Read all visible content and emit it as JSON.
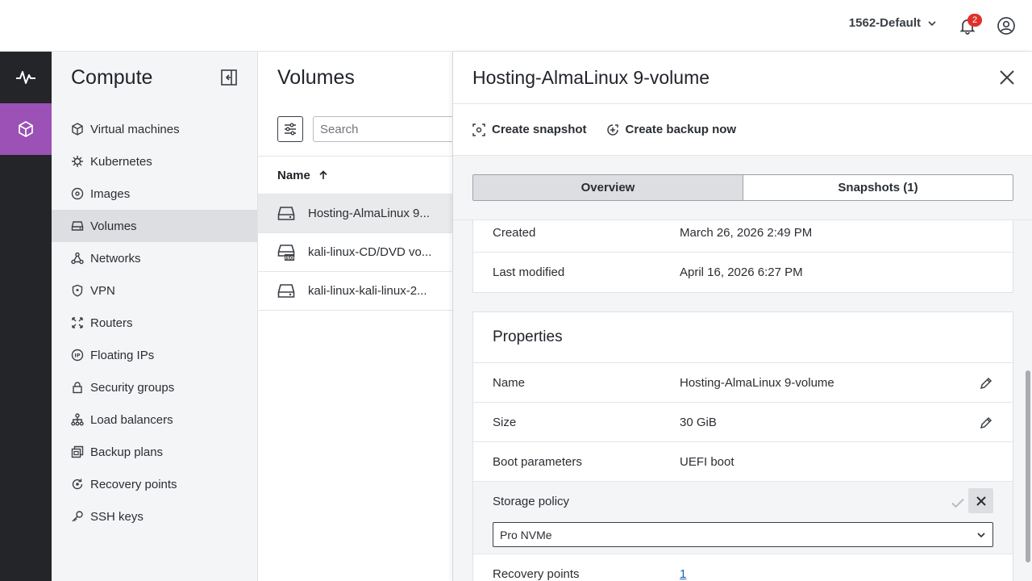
{
  "topbar": {
    "project": "1562-Default",
    "notifications_count": "2"
  },
  "sidenav": {
    "title": "Compute",
    "items": [
      {
        "label": "Virtual machines",
        "icon": "cube-icon"
      },
      {
        "label": "Kubernetes",
        "icon": "helm-icon"
      },
      {
        "label": "Images",
        "icon": "disc-icon"
      },
      {
        "label": "Volumes",
        "icon": "hard-drive-icon",
        "active": true
      },
      {
        "label": "Networks",
        "icon": "network-icon"
      },
      {
        "label": "VPN",
        "icon": "shield-icon"
      },
      {
        "label": "Routers",
        "icon": "router-icon"
      },
      {
        "label": "Floating IPs",
        "icon": "ip-icon"
      },
      {
        "label": "Security groups",
        "icon": "lock-icon"
      },
      {
        "label": "Load balancers",
        "icon": "load-balancer-icon"
      },
      {
        "label": "Backup plans",
        "icon": "backup-icon"
      },
      {
        "label": "Recovery points",
        "icon": "restore-icon"
      },
      {
        "label": "SSH keys",
        "icon": "key-icon"
      }
    ]
  },
  "list": {
    "title": "Volumes",
    "search_placeholder": "Search",
    "column_name": "Name",
    "rows": [
      {
        "name": "Hosting-AlmaLinux 9...",
        "icon": "hard-drive-icon",
        "selected": true
      },
      {
        "name": "kali-linux-CD/DVD vo...",
        "icon": "iso-drive-icon"
      },
      {
        "name": "kali-linux-kali-linux-2...",
        "icon": "hard-drive-icon"
      }
    ]
  },
  "drawer": {
    "title": "Hosting-AlmaLinux 9-volume",
    "actions": {
      "snapshot": "Create snapshot",
      "backup": "Create backup now"
    },
    "tabs": {
      "overview": "Overview",
      "snapshots": "Snapshots (1)"
    },
    "meta": {
      "created_label": "Created",
      "created_value": "March 26, 2026 2:49 PM",
      "modified_label": "Last modified",
      "modified_value": "April 16, 2026 6:27 PM"
    },
    "properties": {
      "title": "Properties",
      "name_label": "Name",
      "name_value": "Hosting-AlmaLinux 9-volume",
      "size_label": "Size",
      "size_value": "30 GiB",
      "boot_label": "Boot parameters",
      "boot_value": "UEFI boot",
      "storage_label": "Storage policy",
      "storage_value": "Pro NVMe",
      "recovery_label": "Recovery points",
      "recovery_value": "1"
    }
  },
  "colors": {
    "accent": "#9b51b5",
    "rail": "#232529",
    "badge": "#e0302a",
    "link": "#1d5fb8"
  }
}
